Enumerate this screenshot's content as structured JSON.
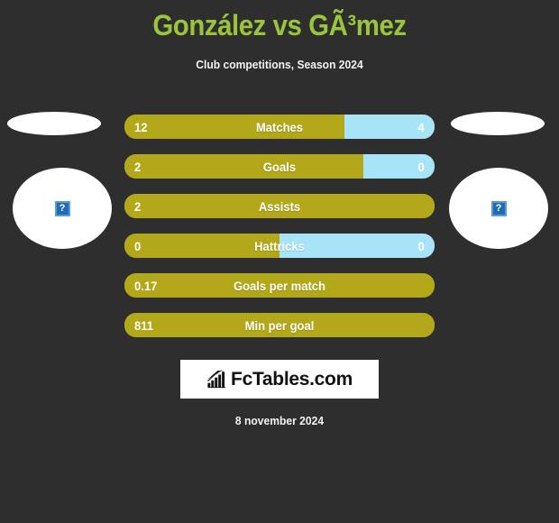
{
  "header": {
    "title": "González vs GÃ³mez",
    "subtitle": "Club competitions, Season 2024"
  },
  "players": {
    "left": {
      "placeholder_icon": "broken-image-icon",
      "placeholder_glyph": "?"
    },
    "right": {
      "placeholder_icon": "broken-image-icon",
      "placeholder_glyph": "?"
    }
  },
  "colors": {
    "background": "#2e2e2e",
    "title": "#9ac43c",
    "bar_left": "#b3a81a",
    "bar_right": "#a8e4f7",
    "text": "#ffffff"
  },
  "chart_data": {
    "type": "bar",
    "title": "González vs GÃ³mez",
    "subtitle": "Club competitions, Season 2024",
    "orientation": "horizontal-diverging",
    "categories": [
      "Matches",
      "Goals",
      "Assists",
      "Hattricks",
      "Goals per match",
      "Min per goal"
    ],
    "series": [
      {
        "name": "González",
        "values": [
          "12",
          "2",
          "2",
          "0",
          "0.17",
          "811"
        ]
      },
      {
        "name": "GÃ³mez",
        "values": [
          "4",
          "0",
          "",
          "0",
          "",
          ""
        ]
      }
    ],
    "rows": [
      {
        "label": "Matches",
        "left_value": "12",
        "right_value": "4",
        "left_pct": 71,
        "has_right": true
      },
      {
        "label": "Goals",
        "left_value": "2",
        "right_value": "0",
        "left_pct": 77,
        "has_right": true
      },
      {
        "label": "Assists",
        "left_value": "2",
        "right_value": "",
        "left_pct": 100,
        "has_right": false
      },
      {
        "label": "Hattricks",
        "left_value": "0",
        "right_value": "0",
        "left_pct": 50,
        "has_right": true
      },
      {
        "label": "Goals per match",
        "left_value": "0.17",
        "right_value": "",
        "left_pct": 100,
        "has_right": false
      },
      {
        "label": "Min per goal",
        "left_value": "811",
        "right_value": "",
        "left_pct": 100,
        "has_right": false
      }
    ]
  },
  "footer": {
    "logo_text": "FcTables.com",
    "logo_icon": "bar-chart-arrow-icon",
    "date": "8 november 2024"
  }
}
